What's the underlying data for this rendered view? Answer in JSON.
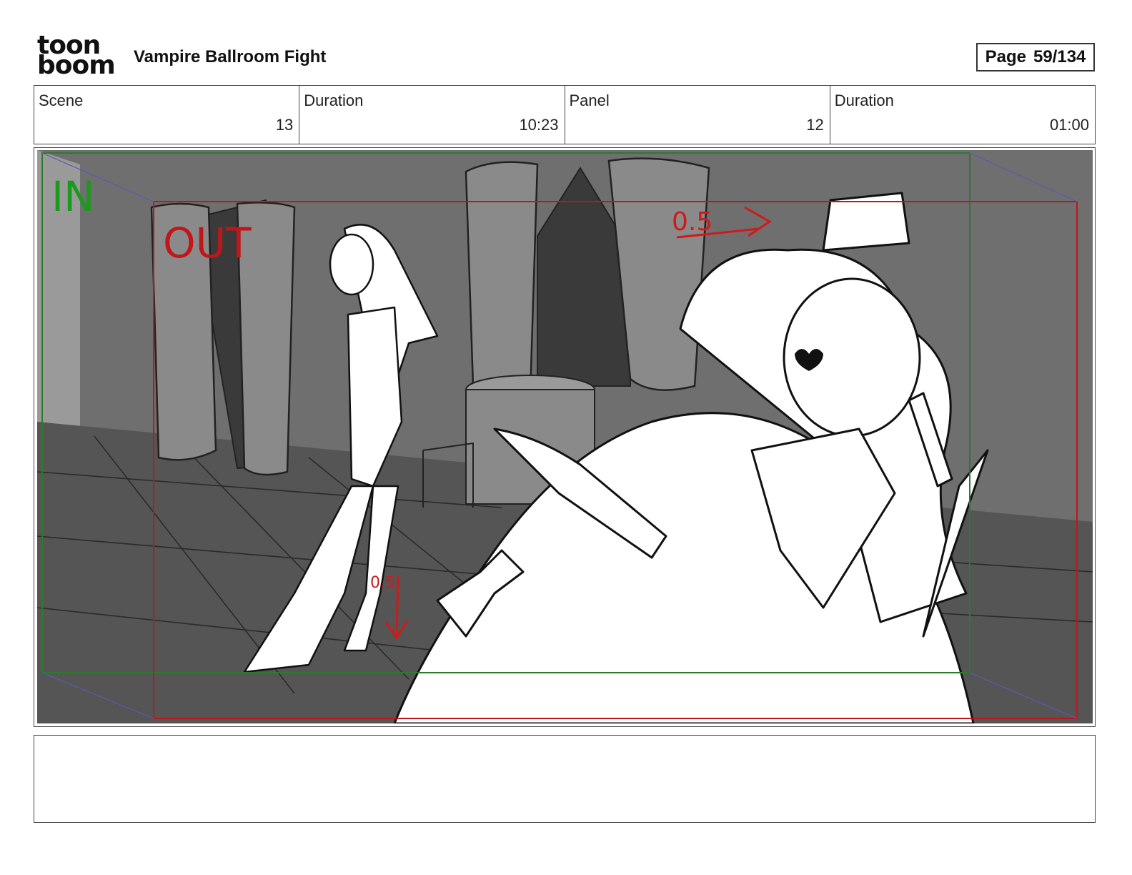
{
  "header": {
    "logo_line1": "toon",
    "logo_line2": "boom",
    "title": "Vampire Ballroom Fight",
    "page_label": "Page",
    "page_value": "59/134"
  },
  "info": {
    "scene_label": "Scene",
    "scene_value": "13",
    "scene_duration_label": "Duration",
    "scene_duration_value": "10:23",
    "panel_label": "Panel",
    "panel_value": "12",
    "panel_duration_label": "Duration",
    "panel_duration_value": "01:00"
  },
  "panel": {
    "in_label": "IN",
    "out_label": "OUT",
    "note_top": "0.5",
    "note_bottom": "0.5",
    "in_color": "#1a9a1a",
    "out_color": "#c0161a",
    "bg_color": "#6b6b6b"
  },
  "notes": {
    "text": ""
  }
}
